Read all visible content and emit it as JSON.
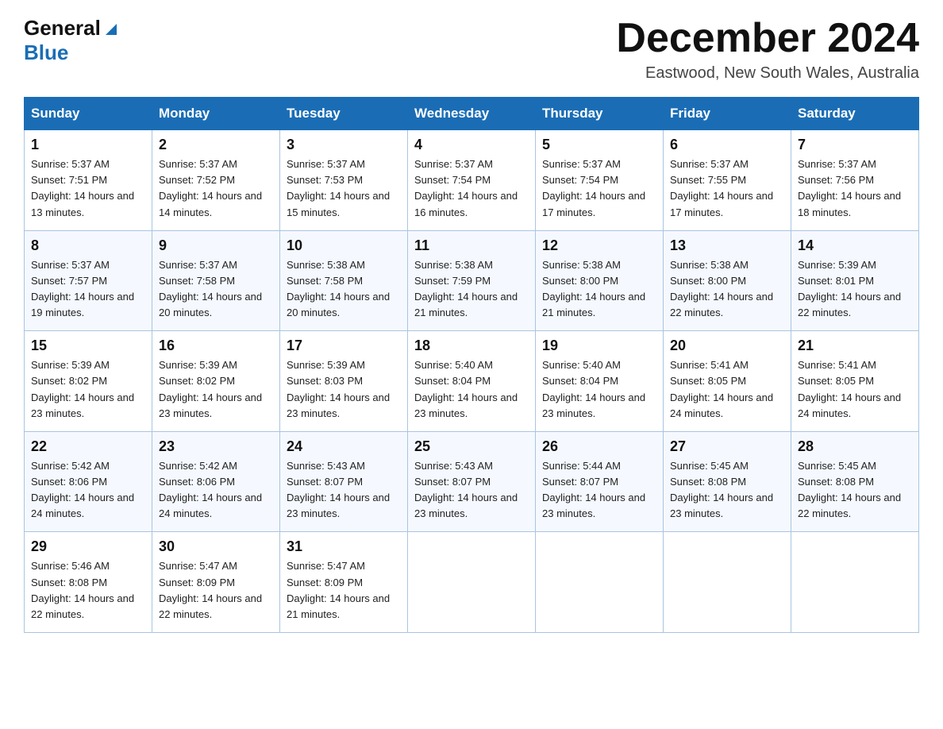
{
  "header": {
    "logo_line1": "General",
    "logo_line2": "Blue",
    "month_title": "December 2024",
    "location": "Eastwood, New South Wales, Australia"
  },
  "days_of_week": [
    "Sunday",
    "Monday",
    "Tuesday",
    "Wednesday",
    "Thursday",
    "Friday",
    "Saturday"
  ],
  "weeks": [
    [
      {
        "day": "1",
        "sunrise": "5:37 AM",
        "sunset": "7:51 PM",
        "daylight": "14 hours and 13 minutes."
      },
      {
        "day": "2",
        "sunrise": "5:37 AM",
        "sunset": "7:52 PM",
        "daylight": "14 hours and 14 minutes."
      },
      {
        "day": "3",
        "sunrise": "5:37 AM",
        "sunset": "7:53 PM",
        "daylight": "14 hours and 15 minutes."
      },
      {
        "day": "4",
        "sunrise": "5:37 AM",
        "sunset": "7:54 PM",
        "daylight": "14 hours and 16 minutes."
      },
      {
        "day": "5",
        "sunrise": "5:37 AM",
        "sunset": "7:54 PM",
        "daylight": "14 hours and 17 minutes."
      },
      {
        "day": "6",
        "sunrise": "5:37 AM",
        "sunset": "7:55 PM",
        "daylight": "14 hours and 17 minutes."
      },
      {
        "day": "7",
        "sunrise": "5:37 AM",
        "sunset": "7:56 PM",
        "daylight": "14 hours and 18 minutes."
      }
    ],
    [
      {
        "day": "8",
        "sunrise": "5:37 AM",
        "sunset": "7:57 PM",
        "daylight": "14 hours and 19 minutes."
      },
      {
        "day": "9",
        "sunrise": "5:37 AM",
        "sunset": "7:58 PM",
        "daylight": "14 hours and 20 minutes."
      },
      {
        "day": "10",
        "sunrise": "5:38 AM",
        "sunset": "7:58 PM",
        "daylight": "14 hours and 20 minutes."
      },
      {
        "day": "11",
        "sunrise": "5:38 AM",
        "sunset": "7:59 PM",
        "daylight": "14 hours and 21 minutes."
      },
      {
        "day": "12",
        "sunrise": "5:38 AM",
        "sunset": "8:00 PM",
        "daylight": "14 hours and 21 minutes."
      },
      {
        "day": "13",
        "sunrise": "5:38 AM",
        "sunset": "8:00 PM",
        "daylight": "14 hours and 22 minutes."
      },
      {
        "day": "14",
        "sunrise": "5:39 AM",
        "sunset": "8:01 PM",
        "daylight": "14 hours and 22 minutes."
      }
    ],
    [
      {
        "day": "15",
        "sunrise": "5:39 AM",
        "sunset": "8:02 PM",
        "daylight": "14 hours and 23 minutes."
      },
      {
        "day": "16",
        "sunrise": "5:39 AM",
        "sunset": "8:02 PM",
        "daylight": "14 hours and 23 minutes."
      },
      {
        "day": "17",
        "sunrise": "5:39 AM",
        "sunset": "8:03 PM",
        "daylight": "14 hours and 23 minutes."
      },
      {
        "day": "18",
        "sunrise": "5:40 AM",
        "sunset": "8:04 PM",
        "daylight": "14 hours and 23 minutes."
      },
      {
        "day": "19",
        "sunrise": "5:40 AM",
        "sunset": "8:04 PM",
        "daylight": "14 hours and 23 minutes."
      },
      {
        "day": "20",
        "sunrise": "5:41 AM",
        "sunset": "8:05 PM",
        "daylight": "14 hours and 24 minutes."
      },
      {
        "day": "21",
        "sunrise": "5:41 AM",
        "sunset": "8:05 PM",
        "daylight": "14 hours and 24 minutes."
      }
    ],
    [
      {
        "day": "22",
        "sunrise": "5:42 AM",
        "sunset": "8:06 PM",
        "daylight": "14 hours and 24 minutes."
      },
      {
        "day": "23",
        "sunrise": "5:42 AM",
        "sunset": "8:06 PM",
        "daylight": "14 hours and 24 minutes."
      },
      {
        "day": "24",
        "sunrise": "5:43 AM",
        "sunset": "8:07 PM",
        "daylight": "14 hours and 23 minutes."
      },
      {
        "day": "25",
        "sunrise": "5:43 AM",
        "sunset": "8:07 PM",
        "daylight": "14 hours and 23 minutes."
      },
      {
        "day": "26",
        "sunrise": "5:44 AM",
        "sunset": "8:07 PM",
        "daylight": "14 hours and 23 minutes."
      },
      {
        "day": "27",
        "sunrise": "5:45 AM",
        "sunset": "8:08 PM",
        "daylight": "14 hours and 23 minutes."
      },
      {
        "day": "28",
        "sunrise": "5:45 AM",
        "sunset": "8:08 PM",
        "daylight": "14 hours and 22 minutes."
      }
    ],
    [
      {
        "day": "29",
        "sunrise": "5:46 AM",
        "sunset": "8:08 PM",
        "daylight": "14 hours and 22 minutes."
      },
      {
        "day": "30",
        "sunrise": "5:47 AM",
        "sunset": "8:09 PM",
        "daylight": "14 hours and 22 minutes."
      },
      {
        "day": "31",
        "sunrise": "5:47 AM",
        "sunset": "8:09 PM",
        "daylight": "14 hours and 21 minutes."
      },
      null,
      null,
      null,
      null
    ]
  ]
}
